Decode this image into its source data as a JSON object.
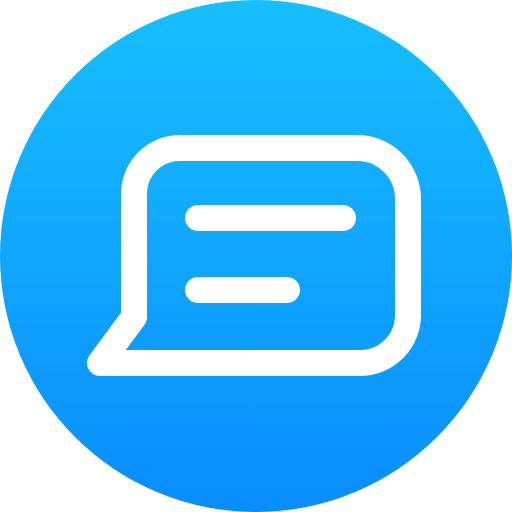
{
  "icon": {
    "name": "chat-message-icon",
    "colors": {
      "gradient_top": "#16BFFD",
      "gradient_bottom": "#0A8DFF",
      "stroke": "#FFFFFF"
    }
  }
}
